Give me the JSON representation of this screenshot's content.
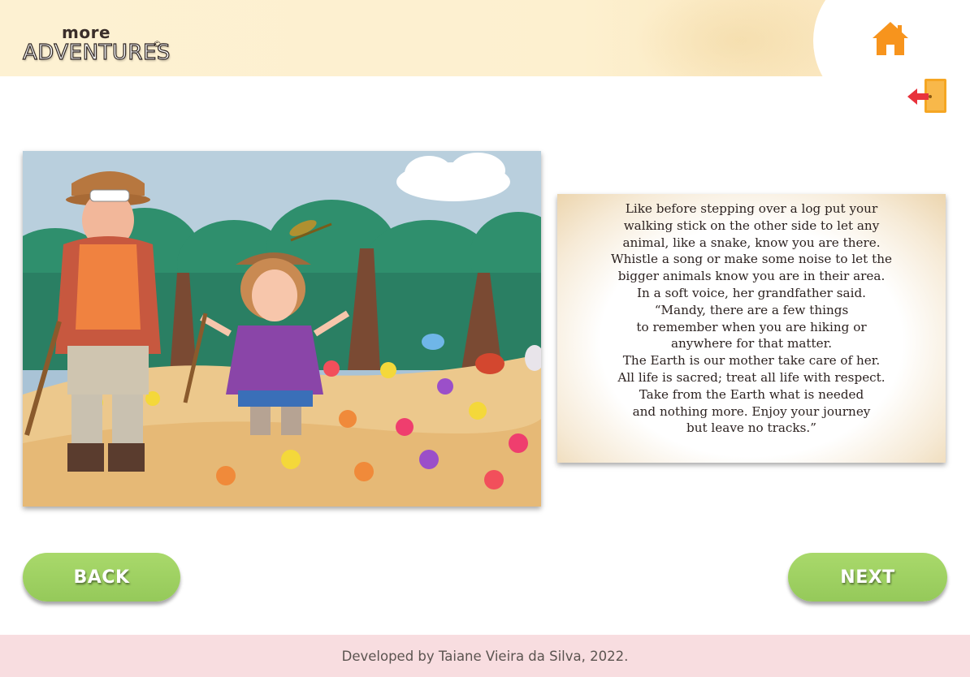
{
  "header": {
    "logo": {
      "top_text": "more",
      "bottom_text": "ADVENTURES",
      "mark": "©"
    },
    "home_icon": "home-icon",
    "exit_icon": "exit-door-icon",
    "home_color": "#f7941d",
    "exit_door_color": "#f5a623",
    "exit_arrow_color": "#e8323c"
  },
  "page": {
    "illustration_alt": "Grandfather and Mandy on a hike in a flower meadow",
    "story_lines": [
      "Like before stepping over a log put your",
      "walking stick on the other side to let any",
      "animal, like a snake, know you are there.",
      "Whistle a song or make some noise to let the",
      "bigger animals know you are in their area.",
      "In a soft voice, her grandfather said.",
      "“Mandy, there are a few things",
      "to remember when you are hiking or",
      "anywhere for that matter.",
      "The Earth is our mother take care of her.",
      "All life is sacred; treat all life with respect.",
      "Take from the Earth what is needed",
      "and nothing more. Enjoy your journey",
      "but leave no tracks.”"
    ]
  },
  "nav": {
    "back_label": "BACK",
    "next_label": "NEXT",
    "button_color": "#9fd163"
  },
  "footer": {
    "text": "Developed by Taiane Vieira da Silva, 2022."
  }
}
